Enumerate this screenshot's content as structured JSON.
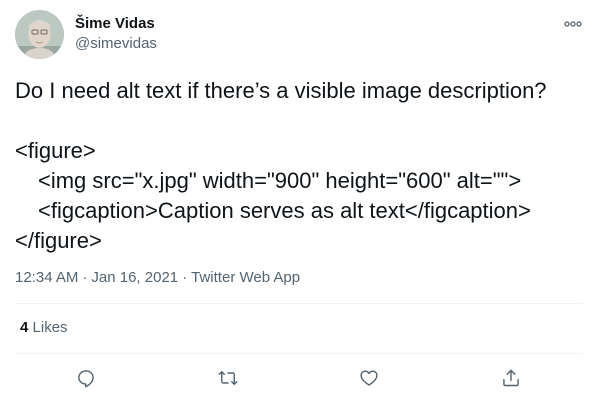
{
  "author": {
    "display_name": "Šime Vidas",
    "handle": "@simevidas"
  },
  "tweet": {
    "question": "Do I need alt text if there’s a visible image description?",
    "code_lines": [
      "<figure>",
      "<img src=\"x.jpg\" width=\"900\" height=\"600\" alt=\"\">",
      "<figcaption>Caption serves as alt text</figcaption>",
      "</figure>"
    ]
  },
  "meta": {
    "time": "12:34 AM",
    "separator": "·",
    "date": "Jan 16, 2021",
    "source": "Twitter Web App"
  },
  "stats": {
    "likes_count": "4",
    "likes_label": "Likes"
  },
  "icons": {
    "more": "more-dots-icon",
    "reply": "reply-icon",
    "retweet": "retweet-icon",
    "like": "like-icon",
    "share": "share-icon"
  },
  "colors": {
    "text": "#0f1419",
    "secondary": "#536471",
    "divider": "#eff3f4",
    "icon": "#536471"
  }
}
